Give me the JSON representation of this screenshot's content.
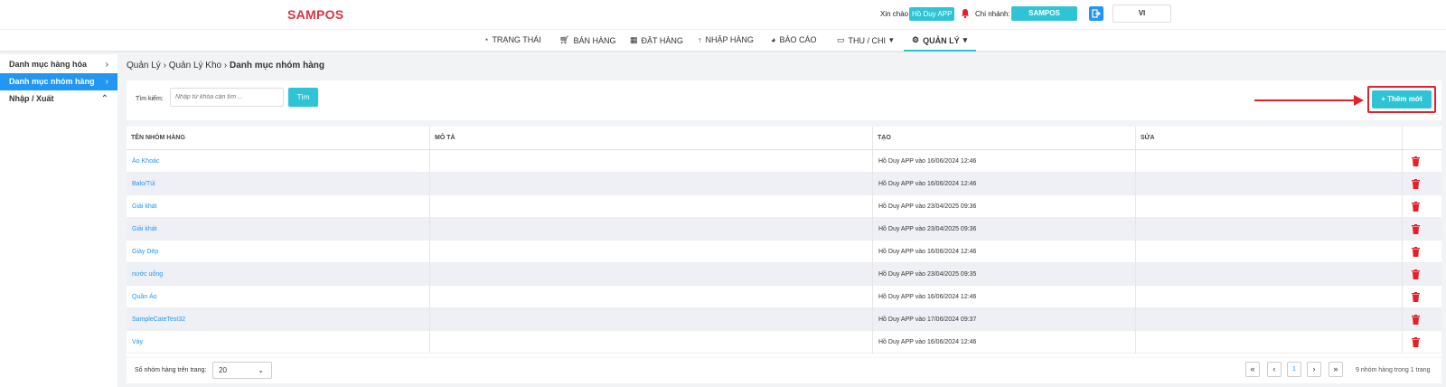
{
  "header": {
    "logo": "SAMPOS",
    "greeting": "Xin chào",
    "user": "Hồ Duy APP",
    "branch_label": "Chi nhánh:",
    "branch": "SAMPOS",
    "language": "VI"
  },
  "nav": {
    "items": [
      {
        "label": "TRẠNG THÁI",
        "icon": "dashboard-icon"
      },
      {
        "label": "BÁN HÀNG",
        "icon": "cart-icon"
      },
      {
        "label": "ĐẶT HÀNG",
        "icon": "calendar-icon"
      },
      {
        "label": "NHẬP HÀNG",
        "icon": "arrow-up-icon"
      },
      {
        "label": "BÁO CÁO",
        "icon": "pie-chart-icon"
      },
      {
        "label": "THU / CHI",
        "icon": "money-icon"
      },
      {
        "label": "QUẢN LÝ",
        "icon": "gear-icon"
      }
    ]
  },
  "sidebar": {
    "items": [
      {
        "label": "Danh mục hàng hóa",
        "chevron": "›"
      },
      {
        "label": "Danh mục nhóm hàng",
        "chevron": "›"
      },
      {
        "label": "Nhập / Xuất",
        "chevron": "⌃"
      }
    ]
  },
  "breadcrumb": {
    "level1": "Quản Lý",
    "level2": "Quản Lý Kho",
    "current": "Danh mục nhóm hàng"
  },
  "search": {
    "label": "Tìm kiếm:",
    "placeholder": "Nhập từ khóa cần tìm ...",
    "button": "Tìm"
  },
  "actions": {
    "add_label": "+ Thêm mới"
  },
  "table": {
    "columns": [
      "TÊN NHÓM HÀNG",
      "MÔ TẢ",
      "TẠO",
      "SỬA"
    ],
    "rows": [
      {
        "name": "Áo Khoác",
        "desc": "",
        "created": "Hồ Duy APP vào 16/06/2024 12:46",
        "edited": ""
      },
      {
        "name": "Balo/Túi",
        "desc": "",
        "created": "Hồ Duy APP vào 16/06/2024 12:46",
        "edited": ""
      },
      {
        "name": "Giải khát",
        "desc": "",
        "created": "Hồ Duy APP vào 23/04/2025 09:36",
        "edited": ""
      },
      {
        "name": "Giải khát",
        "desc": "",
        "created": "Hồ Duy APP vào 23/04/2025 09:36",
        "edited": ""
      },
      {
        "name": "Giày Dép",
        "desc": "",
        "created": "Hồ Duy APP vào 16/06/2024 12:46",
        "edited": ""
      },
      {
        "name": "nước uống",
        "desc": "",
        "created": "Hồ Duy APP vào 23/04/2025 09:35",
        "edited": ""
      },
      {
        "name": "Quần Áo",
        "desc": "",
        "created": "Hồ Duy APP vào 16/06/2024 12:46",
        "edited": ""
      },
      {
        "name": "SampleCateTest32",
        "desc": "",
        "created": "Hồ Duy APP vào 17/06/2024 09:37",
        "edited": ""
      },
      {
        "name": "Váy",
        "desc": "",
        "created": "Hồ Duy APP vào 16/06/2024 12:46",
        "edited": ""
      }
    ]
  },
  "pagination": {
    "per_page_label": "Số nhóm hàng trên trang:",
    "per_page": "20",
    "first": "«",
    "prev": "‹",
    "current_page": "1",
    "next": "›",
    "last": "»",
    "info": "9 nhóm hàng trong 1 trang"
  },
  "colors": {
    "brand": "#d9323f",
    "accent": "#2ec4d6",
    "active_sidebar": "#2196f3",
    "link": "#2196f3",
    "delete": "#e5202a",
    "highlight": "#e5202a"
  }
}
